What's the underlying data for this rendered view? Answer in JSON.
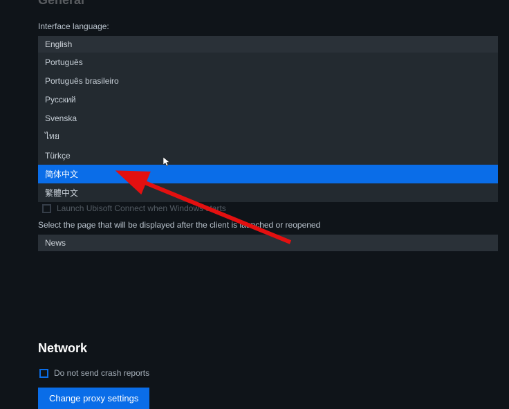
{
  "section_general_cut": "General",
  "interface_language": {
    "label": "Interface language:",
    "selected": "English",
    "options": [
      "Português",
      "Português brasileiro",
      "Русский",
      "Svenska",
      "ไทย",
      "Türkçe",
      "简体中文",
      "繁體中文"
    ],
    "highlighted_index": 6
  },
  "obscured_checkbox": {
    "label": "Launch Ubisoft Connect when Windows starts"
  },
  "startup_page": {
    "label": "Select the page that will be displayed after the client is launched or reopened",
    "selected": "News"
  },
  "section_network": "Network",
  "crash_reports_checkbox": {
    "label": "Do not send crash reports"
  },
  "proxy_button": {
    "label": "Change proxy settings"
  }
}
